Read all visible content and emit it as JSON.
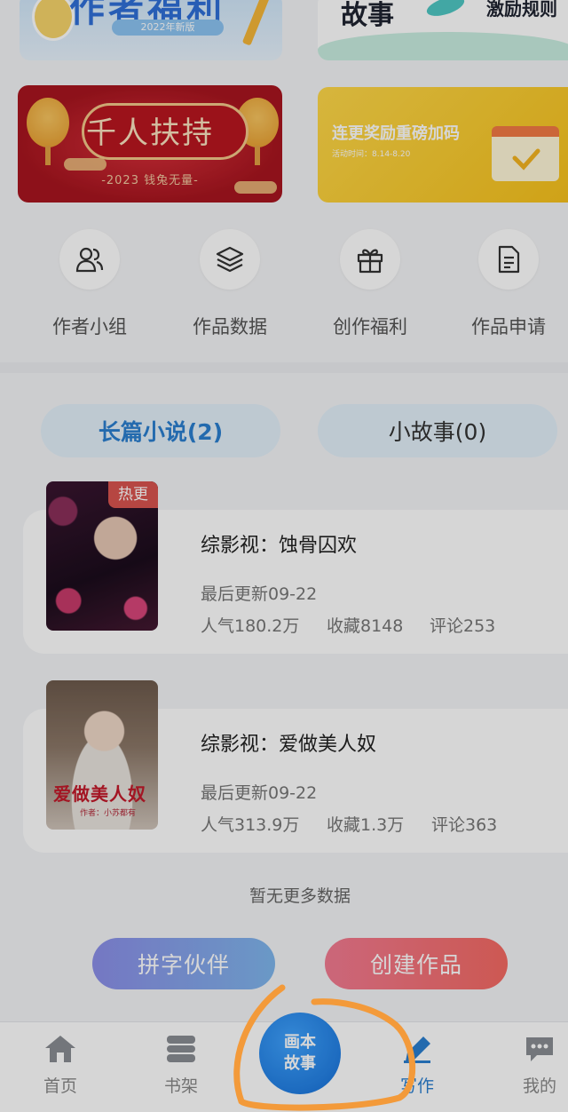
{
  "banners": {
    "top_left": {
      "title": "作者福利",
      "version": "2022年新版"
    },
    "top_right": {
      "title": "故事",
      "subtitle": "激励规则"
    },
    "red": {
      "title": "千人扶持",
      "subtitle": "-2023 钱兔无量-"
    },
    "yellow": {
      "title": "连更奖励重磅加码",
      "subtitle": "活动时间：8.14-8.20"
    }
  },
  "quick_entries": [
    {
      "label": "作者小组",
      "icon": "users-icon"
    },
    {
      "label": "作品数据",
      "icon": "layers-icon"
    },
    {
      "label": "创作福利",
      "icon": "gift-icon"
    },
    {
      "label": "作品申请",
      "icon": "document-icon"
    }
  ],
  "tabs": [
    {
      "label": "长篇小说(2)",
      "active": true
    },
    {
      "label": "小故事(0)",
      "active": false
    }
  ],
  "works": [
    {
      "badge": "热更",
      "title": "综影视：蚀骨囚欢",
      "updated": "最后更新09-22",
      "popularity": "人气180.2万",
      "favorites": "收藏8148",
      "comments": "评论253"
    },
    {
      "badge": "",
      "title": "综影视：爱做美人奴",
      "cover_title": "爱做美人奴",
      "cover_by": "作者：小苏都有",
      "updated": "最后更新09-22",
      "popularity": "人气313.9万",
      "favorites": "收藏1.3万",
      "comments": "评论363"
    }
  ],
  "no_more": "暂无更多数据",
  "actions": {
    "pin_label": "拼字伙伴",
    "create_label": "创建作品"
  },
  "bottom_nav": {
    "home": "首页",
    "shelf": "书架",
    "center_line1": "画本",
    "center_line2": "故事",
    "write": "写作",
    "mine": "我的"
  },
  "colors": {
    "accent": "#2a7fd0",
    "annotation": "#f39a3a",
    "hot_badge": "#d9544f"
  }
}
